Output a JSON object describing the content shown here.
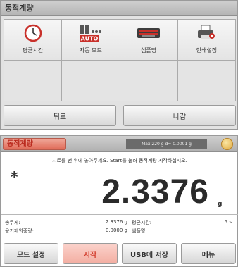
{
  "menu_screen": {
    "title": "동적계량",
    "tiles": [
      {
        "label": "평균시간",
        "icon": "clock-icon"
      },
      {
        "label": "자동 모드",
        "icon": "auto-mode-icon"
      },
      {
        "label": "샘플명",
        "icon": "keyboard-icon"
      },
      {
        "label": "인쇄설정",
        "icon": "printer-icon"
      }
    ],
    "back_label": "뒤로",
    "exit_label": "나감"
  },
  "weigh_screen": {
    "title": "동적계량",
    "spec": "Max 220 g   d= 0.0001 g",
    "level_icon": "level-bubble-icon",
    "instruction": "시료를 팬 위에 놓아주세요. Start를 눌러 동적계량 시작하십시오.",
    "stability_mark": "*",
    "reading": "2.3376",
    "unit": "g",
    "info": {
      "gross_label": "총무게:",
      "gross_value": "2.3376 g",
      "avg_time_label": "평균시간:",
      "avg_time_value": "5 s",
      "tare_label": "용기제외중량:",
      "tare_value": "0.0000 g",
      "sample_label": "샘플명:"
    },
    "buttons": {
      "mode_setup": "모드 설정",
      "start": "시작",
      "usb_save": "USB에 저장",
      "menu": "메뉴"
    }
  },
  "colors": {
    "accent_red": "#d23a2a",
    "title_bg": "#e06b58",
    "level_gold": "#e0a83c"
  }
}
